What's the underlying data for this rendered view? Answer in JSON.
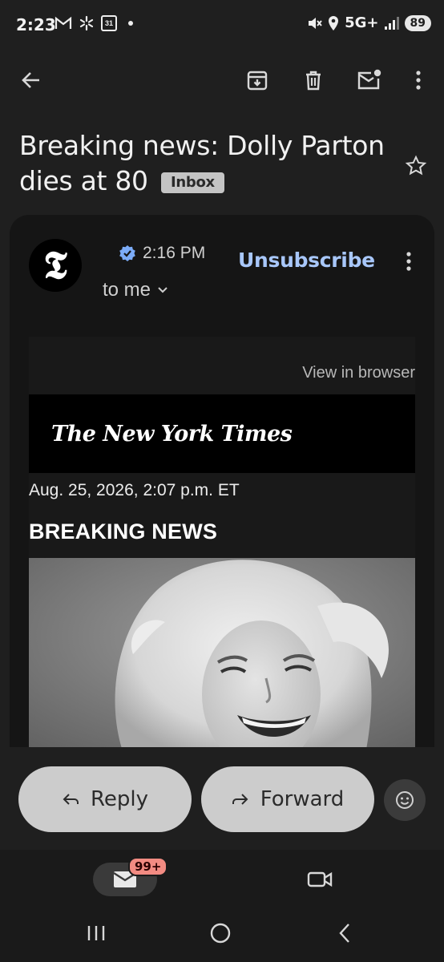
{
  "status_bar": {
    "time": "2:23",
    "network": "5G+",
    "battery": "89",
    "icons_left": [
      "gmail-icon",
      "pinwheel-icon",
      "calendar-icon",
      "dot-icon"
    ],
    "icons_right": [
      "mute-icon",
      "location-icon",
      "signal-icon",
      "battery-icon"
    ],
    "calendar_day": "31"
  },
  "toolbar": {
    "icons": [
      "back-arrow-icon",
      "archive-icon",
      "delete-icon",
      "mark-unread-icon",
      "more-vert-icon"
    ]
  },
  "subject": {
    "text": "Breaking news: Dolly Parton dies at 80",
    "label": "Inbox"
  },
  "message": {
    "sender_avatar_glyph": "𝕿",
    "time": "2:16 PM",
    "recipient": "to me",
    "unsubscribe": "Unsubscribe"
  },
  "email_body": {
    "view_in_browser": "View in browser",
    "masthead": "The New York Times",
    "dateline": "Aug. 25, 2026, 2:07 p.m. ET",
    "section": "BREAKING NEWS"
  },
  "actions": {
    "reply": "Reply",
    "forward": "Forward"
  },
  "bottom_nav": {
    "mail_badge": "99+"
  },
  "colors": {
    "background": "#1f1f1f",
    "card": "#151515",
    "accent_link": "#a8c7fa",
    "pill": "#cccccc",
    "badge": "#f28b82"
  }
}
